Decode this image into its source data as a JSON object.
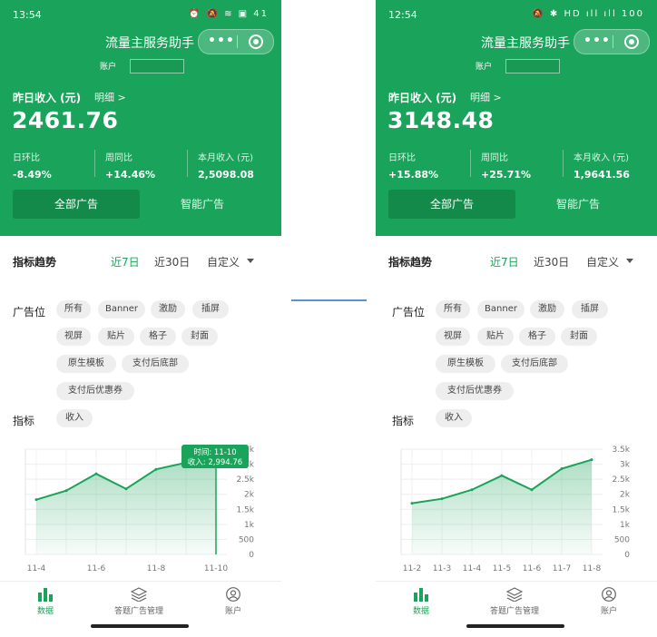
{
  "colors": {
    "brand": "#1aa35a",
    "brand_dark": "#138a4a",
    "divider": "#5b8fd6"
  },
  "panels": [
    {
      "status_time": "13:54",
      "status_icons": "⏰ 🔕 ≋ ▣ 41",
      "app_title": "流量主服务助手",
      "account_label": "账户",
      "income_label": "昨日收入 (元)",
      "detail_link": "明细 >",
      "income_value": "2461.76",
      "stats": [
        {
          "label": "日环比",
          "value": "-8.49%"
        },
        {
          "label": "周同比",
          "value": "+14.46%"
        },
        {
          "label": "本月收入 (元)",
          "value": "2,5098.08"
        }
      ],
      "ad_tabs": [
        "全部广告",
        "智能广告"
      ],
      "trend_title": "指标趋势",
      "ranges": [
        "近7日",
        "近30日",
        "自定义"
      ],
      "ad_position_label": "广告位",
      "chips": [
        "所有",
        "Banner",
        "激励",
        "插屏",
        "视屏",
        "贴片",
        "格子",
        "封面",
        "原生模板",
        "支付后底部",
        "支付后优惠券"
      ],
      "metric_label": "指标",
      "metric_chip": "收入",
      "tooltip": {
        "line1": "时间: 11-10",
        "line2": "收入: 2,994.76"
      },
      "chart_data": {
        "type": "area",
        "x": [
          "11-4",
          "11-5",
          "11-6",
          "11-7",
          "11-8",
          "11-9",
          "11-10"
        ],
        "x_tick_labels": [
          "11-4",
          "11-6",
          "11-8",
          "11-10"
        ],
        "series": [
          {
            "values": [
              1820,
              2120,
              2680,
              2180,
              2830,
              3050,
              2994.76
            ]
          }
        ],
        "y_ticks": [
          "0",
          "500",
          "1k",
          "1.5k",
          "2k",
          "2.5k",
          "3k",
          "3.5k"
        ],
        "ylim": [
          0,
          3500
        ],
        "grid": true
      },
      "tabbar": [
        "数据",
        "答题广告管理",
        "账户"
      ]
    },
    {
      "status_time": "12:54",
      "status_icons": "🔕 ✱ HD ıll ıll 100",
      "app_title": "流量主服务助手",
      "account_label": "账户",
      "income_label": "昨日收入 (元)",
      "detail_link": "明细 >",
      "income_value": "3148.48",
      "stats": [
        {
          "label": "日环比",
          "value": "+15.88%"
        },
        {
          "label": "周同比",
          "value": "+25.71%"
        },
        {
          "label": "本月收入 (元)",
          "value": "1,9641.56"
        }
      ],
      "ad_tabs": [
        "全部广告",
        "智能广告"
      ],
      "trend_title": "指标趋势",
      "ranges": [
        "近7日",
        "近30日",
        "自定义"
      ],
      "ad_position_label": "广告位",
      "chips": [
        "所有",
        "Banner",
        "激励",
        "插屏",
        "视屏",
        "贴片",
        "格子",
        "封面",
        "原生模板",
        "支付后底部",
        "支付后优惠券"
      ],
      "metric_label": "指标",
      "metric_chip": "收入",
      "chart_data": {
        "type": "area",
        "x": [
          "11-2",
          "11-3",
          "11-4",
          "11-5",
          "11-6",
          "11-7",
          "11-8"
        ],
        "x_tick_labels": [
          "11-2",
          "11-3",
          "11-4",
          "11-5",
          "11-6",
          "11-7",
          "11-8"
        ],
        "series": [
          {
            "values": [
              1700,
              1850,
              2150,
              2620,
              2150,
              2850,
              3148.48
            ]
          }
        ],
        "y_ticks": [
          "0",
          "500",
          "1k",
          "1.5k",
          "2k",
          "2.5k",
          "3k",
          "3.5k"
        ],
        "ylim": [
          0,
          3500
        ],
        "grid": true
      },
      "tabbar": [
        "数据",
        "答题广告管理",
        "账户"
      ]
    }
  ]
}
